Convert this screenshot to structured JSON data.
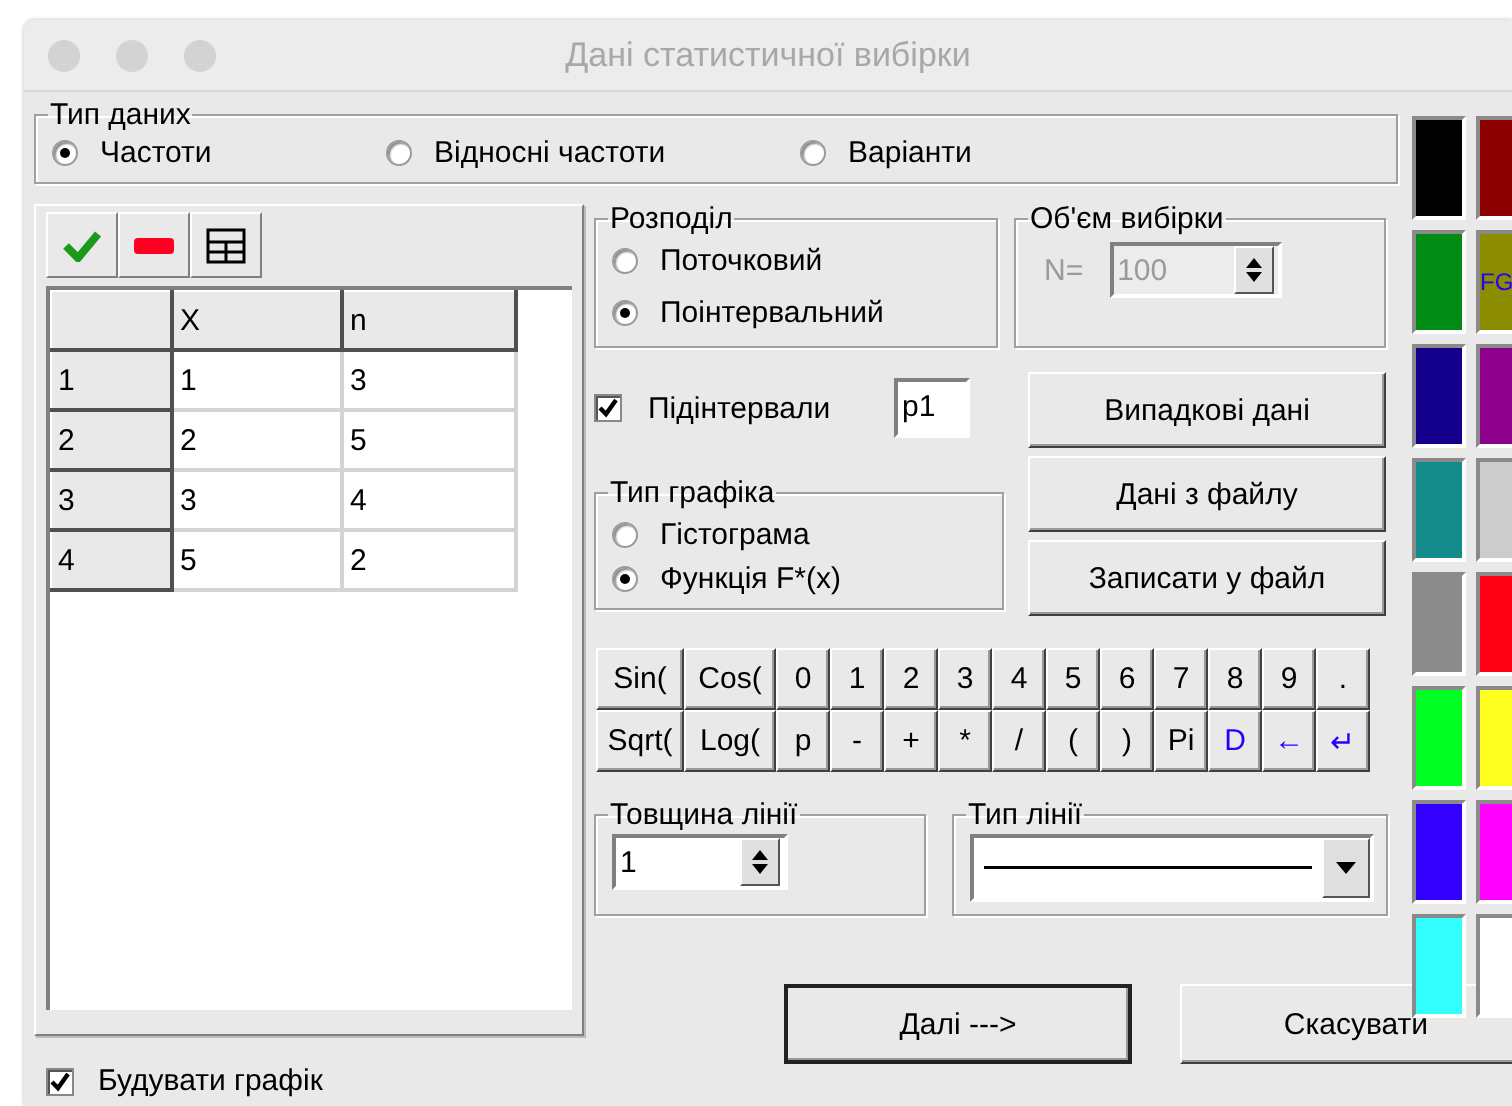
{
  "window": {
    "title": "Дані статистичної вибірки"
  },
  "data_type": {
    "legend": "Тип даних",
    "options": [
      {
        "label": "Частоти",
        "selected": true
      },
      {
        "label": "Відносні частоти",
        "selected": false
      },
      {
        "label": "Варіанти",
        "selected": false
      }
    ]
  },
  "table": {
    "columns": [
      "X",
      "n"
    ],
    "rows": [
      {
        "index": "1",
        "cells": [
          "1",
          "3"
        ]
      },
      {
        "index": "2",
        "cells": [
          "2",
          "5"
        ]
      },
      {
        "index": "3",
        "cells": [
          "3",
          "4"
        ]
      },
      {
        "index": "4",
        "cells": [
          "5",
          "2"
        ]
      }
    ]
  },
  "distribution": {
    "legend": "Розподіл",
    "options": [
      {
        "label": "Поточковий",
        "selected": false
      },
      {
        "label": "Поінтервальний",
        "selected": true
      }
    ]
  },
  "sample_size": {
    "legend": "Об'єм вибірки",
    "label": "N=",
    "value": "100",
    "disabled": true
  },
  "subintervals": {
    "label": "Підінтервали",
    "checked": true,
    "value": "p1"
  },
  "chart_type": {
    "legend": "Тип графіка",
    "options": [
      {
        "label": "Гістограма",
        "selected": false
      },
      {
        "label": "Функція F*(x)",
        "selected": true
      }
    ]
  },
  "actions": [
    "Випадкові дані",
    "Дані з файлу",
    "Записати у файл"
  ],
  "keypad": [
    [
      {
        "label": "Sin(",
        "accent": false
      },
      {
        "label": "Cos(",
        "accent": false
      },
      {
        "label": "0",
        "accent": false
      },
      {
        "label": "1",
        "accent": false
      },
      {
        "label": "2",
        "accent": false
      },
      {
        "label": "3",
        "accent": false
      },
      {
        "label": "4",
        "accent": false
      },
      {
        "label": "5",
        "accent": false
      },
      {
        "label": "6",
        "accent": false
      },
      {
        "label": "7",
        "accent": false
      },
      {
        "label": "8",
        "accent": false
      },
      {
        "label": "9",
        "accent": false
      },
      {
        "label": ".",
        "accent": false
      }
    ],
    [
      {
        "label": "Sqrt(",
        "accent": false
      },
      {
        "label": "Log(",
        "accent": false
      },
      {
        "label": "p",
        "accent": false
      },
      {
        "label": "-",
        "accent": false
      },
      {
        "label": "+",
        "accent": false
      },
      {
        "label": "*",
        "accent": false
      },
      {
        "label": "/",
        "accent": false
      },
      {
        "label": "(",
        "accent": false
      },
      {
        "label": ")",
        "accent": false
      },
      {
        "label": "Pi",
        "accent": false
      },
      {
        "label": "D",
        "accent": true
      },
      {
        "label": "←",
        "accent": true
      },
      {
        "label": "↵",
        "accent": true
      }
    ]
  ],
  "line_width": {
    "legend": "Товщина лінії",
    "value": "1"
  },
  "line_type": {
    "legend": "Тип лінії"
  },
  "palette": [
    {
      "color": "#000000"
    },
    {
      "color": "#8c0000"
    },
    {
      "color": "#008c14"
    },
    {
      "color": "#8c8c00",
      "label": "FG"
    },
    {
      "color": "#14008c"
    },
    {
      "color": "#8c008c"
    },
    {
      "color": "#148c8c"
    },
    {
      "color": "#cccccc"
    },
    {
      "color": "#8c8c8c"
    },
    {
      "color": "#ff0014"
    },
    {
      "color": "#00ff22"
    },
    {
      "color": "#ffff22"
    },
    {
      "color": "#3300ff"
    },
    {
      "color": "#ff00ff"
    },
    {
      "color": "#33ffff"
    },
    {
      "color": "#ffffff"
    }
  ],
  "draw_chart": {
    "label": "Будувати графік",
    "checked": true
  },
  "buttons": [
    "Далі --->",
    "Скасувати"
  ]
}
